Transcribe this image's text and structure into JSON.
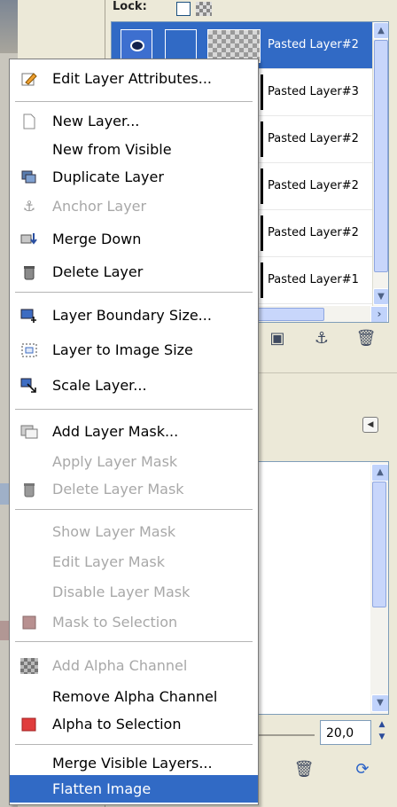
{
  "lock_label": "Lock:",
  "layers": [
    {
      "name": "Pasted Layer#2",
      "selected": true
    },
    {
      "name": "Pasted Layer#3",
      "selected": false
    },
    {
      "name": "Pasted Layer#2",
      "selected": false
    },
    {
      "name": "Pasted Layer#2",
      "selected": false
    },
    {
      "name": "Pasted Layer#2",
      "selected": false
    },
    {
      "name": "Pasted Layer#1",
      "selected": false
    }
  ],
  "spacing_value": "20,0",
  "icons": {
    "edit": "pencil-icon",
    "new": "page-icon",
    "duplicate": "duplicate-icon",
    "anchor": "anchor-icon",
    "merge": "merge-down-icon",
    "delete": "trash-icon",
    "boundary": "boundary-icon",
    "to_image": "fit-icon",
    "scale": "scale-icon",
    "add_mask": "mask-icon",
    "alpha": "checker-icon",
    "alpha_sel": "red-square-icon"
  },
  "menu": {
    "items": [
      {
        "key": "edit_attr",
        "label": "Edit Layer Attributes...",
        "disabled": false
      },
      {
        "key": "new_layer",
        "label": "New Layer...",
        "disabled": false
      },
      {
        "key": "new_from_visible",
        "label": "New from Visible",
        "disabled": false
      },
      {
        "key": "duplicate",
        "label": "Duplicate Layer",
        "disabled": false
      },
      {
        "key": "anchor",
        "label": "Anchor Layer",
        "disabled": true
      },
      {
        "key": "merge_down",
        "label": "Merge Down",
        "disabled": false
      },
      {
        "key": "delete",
        "label": "Delete Layer",
        "disabled": false
      },
      {
        "key": "boundary",
        "label": "Layer Boundary Size...",
        "disabled": false
      },
      {
        "key": "to_image",
        "label": "Layer to Image Size",
        "disabled": false
      },
      {
        "key": "scale",
        "label": "Scale Layer...",
        "disabled": false
      },
      {
        "key": "add_mask",
        "label": "Add Layer Mask...",
        "disabled": false
      },
      {
        "key": "apply_mask",
        "label": "Apply Layer Mask",
        "disabled": true
      },
      {
        "key": "delete_mask",
        "label": "Delete Layer Mask",
        "disabled": true
      },
      {
        "key": "show_mask",
        "label": "Show Layer Mask",
        "disabled": true
      },
      {
        "key": "edit_mask",
        "label": "Edit Layer Mask",
        "disabled": true
      },
      {
        "key": "disable_mask",
        "label": "Disable Layer Mask",
        "disabled": true
      },
      {
        "key": "mask_to_sel",
        "label": "Mask to Selection",
        "disabled": true
      },
      {
        "key": "add_alpha",
        "label": "Add Alpha Channel",
        "disabled": true
      },
      {
        "key": "remove_alpha",
        "label": "Remove Alpha Channel",
        "disabled": false
      },
      {
        "key": "alpha_to_sel",
        "label": "Alpha to Selection",
        "disabled": false
      },
      {
        "key": "merge_visible",
        "label": "Merge Visible Layers...",
        "disabled": false
      },
      {
        "key": "flatten",
        "label": "Flatten Image",
        "disabled": false,
        "highlighted": true
      }
    ]
  },
  "colors": {
    "highlight": "#316ac5",
    "disabled": "#a8a8a8",
    "menu_bg": "#ffffff"
  }
}
